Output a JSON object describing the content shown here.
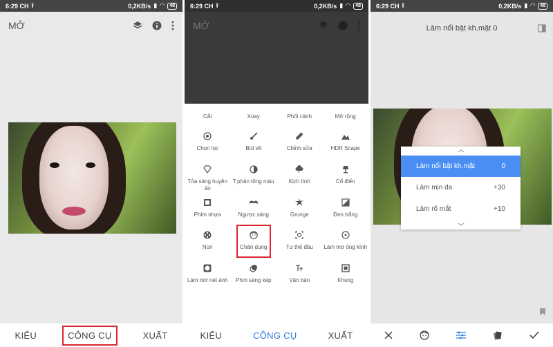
{
  "status": {
    "time": "6:29 CH",
    "speed": "0,2KB/s",
    "battery": "48"
  },
  "panel1": {
    "title": "MỞ",
    "tabs": [
      {
        "label": "KIỂU"
      },
      {
        "label": "CÔNG CỤ"
      },
      {
        "label": "XUẤT"
      }
    ]
  },
  "panel2": {
    "title": "MỞ",
    "tools_top": [
      "Cắt",
      "Xoay",
      "Phối cảnh",
      "Mở rộng"
    ],
    "tools": [
      {
        "label": "Chọn lọc",
        "icon": "target-icon"
      },
      {
        "label": "Bút vẽ",
        "icon": "brush-icon"
      },
      {
        "label": "Chỉnh sửa",
        "icon": "bandage-icon"
      },
      {
        "label": "HDR Scape",
        "icon": "mountain-icon"
      },
      {
        "label": "Tỏa sáng huyền ảo",
        "icon": "diamond-icon"
      },
      {
        "label": "T.phản tông màu",
        "icon": "contrast-icon"
      },
      {
        "label": "Kịch tính",
        "icon": "cloud-icon"
      },
      {
        "label": "Cổ điển",
        "icon": "lamp-icon"
      },
      {
        "label": "Phim nhựa",
        "icon": "film-icon"
      },
      {
        "label": "Ngược sáng",
        "icon": "mustache-icon"
      },
      {
        "label": "Grunge",
        "icon": "grunge-icon"
      },
      {
        "label": "Đen trắng",
        "icon": "bw-icon"
      },
      {
        "label": "Noir",
        "icon": "reel-icon"
      },
      {
        "label": "Chân dung",
        "icon": "face-icon"
      },
      {
        "label": "Tư thế đầu",
        "icon": "head-pose-icon"
      },
      {
        "label": "Làm mờ ống kính",
        "icon": "lens-blur-icon"
      },
      {
        "label": "Làm mờ nét ảnh",
        "icon": "vignette-icon"
      },
      {
        "label": "Phơi sáng kép",
        "icon": "double-exposure-icon"
      },
      {
        "label": "Văn bản",
        "icon": "text-icon"
      },
      {
        "label": "Khung",
        "icon": "frame-icon"
      }
    ],
    "tabs": [
      {
        "label": "KIỂU"
      },
      {
        "label": "CÔNG CỤ"
      },
      {
        "label": "XUẤT"
      }
    ]
  },
  "panel3": {
    "title": "Làm nổi bật kh.mặt 0",
    "options": [
      {
        "label": "Làm nổi bật kh.mặt",
        "value": "0"
      },
      {
        "label": "Làm mịn da",
        "value": "+30"
      },
      {
        "label": "Làm rõ mắt",
        "value": "+10"
      }
    ]
  },
  "colors": {
    "accent": "#2979d9",
    "highlight": "#d9262c",
    "selected_row": "#4a8ef4"
  }
}
